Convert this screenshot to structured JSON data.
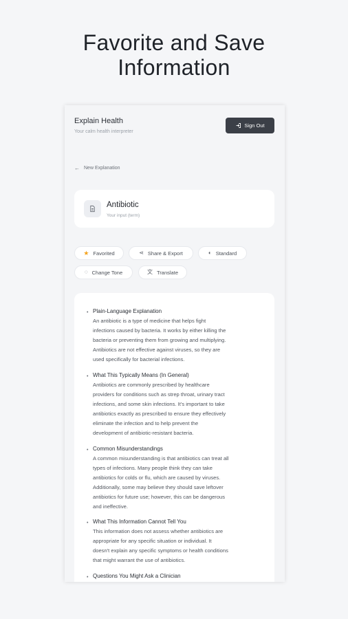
{
  "hero": {
    "line1": "Favorite and Save",
    "line2": "Information"
  },
  "header": {
    "title": "Explain Health",
    "subtitle": "Your calm health interpreter",
    "sign_out": "Sign Out"
  },
  "nav": {
    "back_label": "New Explanation"
  },
  "term": {
    "title": "Antibiotic",
    "subtitle": "Your input (term)"
  },
  "actions": {
    "favorited": "Favorited",
    "share": "Share & Export",
    "standard": "Standard",
    "change_tone": "Change Tone",
    "translate": "Translate"
  },
  "colors": {
    "accent_star": "#f4a21b",
    "button_dark": "#3b3f47"
  },
  "sections": [
    {
      "heading": "Plain-Language Explanation",
      "lines": [
        "An antibiotic is a type of medicine that helps fight",
        "infections caused by bacteria. It works by either killing the",
        "bacteria or preventing them from growing and multiplying.",
        "Antibiotics are not effective against viruses, so they are",
        "used specifically for bacterial infections."
      ]
    },
    {
      "heading": "What This Typically Means (In General)",
      "lines": [
        "Antibiotics are commonly prescribed by healthcare",
        "providers for conditions such as strep throat, urinary tract",
        "infections, and some skin infections. It's important to take",
        "antibiotics exactly as prescribed to ensure they effectively",
        "eliminate the infection and to help prevent the",
        "development of antibiotic-resistant bacteria."
      ]
    },
    {
      "heading": "Common Misunderstandings",
      "lines": [
        "A common misunderstanding is that antibiotics can treat all",
        "types of infections. Many people think they can take",
        "antibiotics for colds or flu, which are caused by viruses.",
        "Additionally, some may believe they should save leftover",
        "antibiotics for future use; however, this can be dangerous",
        "and ineffective."
      ]
    },
    {
      "heading": "What This Information Cannot Tell You",
      "lines": [
        "This information does not assess whether antibiotics are",
        "appropriate for any specific situation or individual. It",
        "doesn't explain any specific symptoms or health conditions",
        "that might warrant the use of antibiotics."
      ]
    },
    {
      "heading": "Questions You Might Ask a Clinician",
      "lines": []
    }
  ]
}
